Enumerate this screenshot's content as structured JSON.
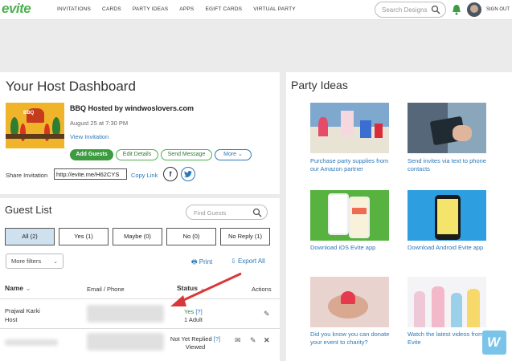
{
  "nav": {
    "logo": "evite",
    "links": [
      "INVITATIONS",
      "CARDS",
      "PARTY IDEAS",
      "APPS",
      "EGIFT CARDS",
      "VIRTUAL PARTY"
    ],
    "search_placeholder": "Search Designs",
    "signout": "SIGN OUT"
  },
  "host": {
    "title": "Your Host Dashboard",
    "thumbnail_text": "BBQ",
    "event_name": "BBQ Hosted by windwoslovers.com",
    "event_date": "August 25 at 7:30 PM",
    "view_invitation": "View Invitation",
    "buttons": {
      "add_guests": "Add Guests",
      "edit_details": "Edit Details",
      "send_message": "Send Message",
      "more": "More"
    },
    "share_label": "Share Invitation",
    "share_url": "http://evite.me/H62CYS",
    "copy_link": "Copy Link",
    "facebook": "f",
    "twitter": "t"
  },
  "guests": {
    "title": "Guest List",
    "find_placeholder": "Find Guests",
    "filters": [
      "All (2)",
      "Yes (1)",
      "Maybe (0)",
      "No (0)",
      "No Reply (1)"
    ],
    "more_filters": "More filters",
    "print": "Print",
    "export_all": "Export All",
    "columns": {
      "name": "Name",
      "email": "Email / Phone",
      "status": "Status",
      "actions": "Actions"
    },
    "rows": [
      {
        "name": "Prajwal Karki",
        "role": "Host",
        "status": "Yes",
        "help": "[?]",
        "detail": "1 Adult"
      },
      {
        "status": "Not Yet Replied",
        "help": "[?]",
        "detail": "Viewed"
      }
    ]
  },
  "party": {
    "title": "Party Ideas",
    "cards": [
      "Purchase party supplies from our Amazon partner",
      "Send invites via text to phone contacts",
      "Download iOS Evite app",
      "Download Android Evite app",
      "Did you know you can donate your event to charity?",
      "Watch the latest videos from Evite"
    ]
  },
  "colors": {
    "brand_green": "#4caf50",
    "link_blue": "#2b78b9",
    "active_filter": "#cfe0ef",
    "arrow": "#d9383a"
  }
}
